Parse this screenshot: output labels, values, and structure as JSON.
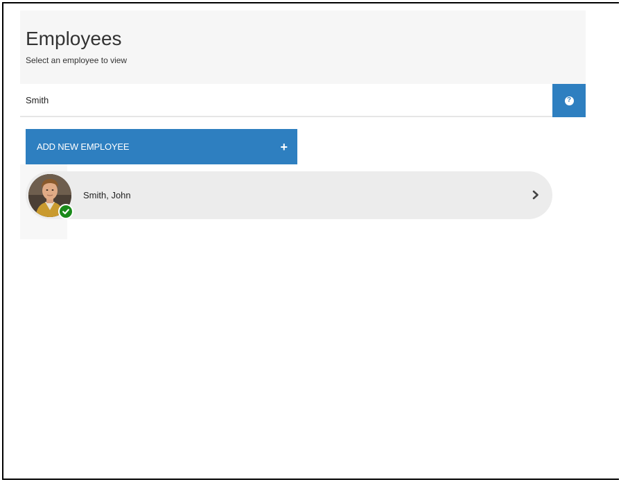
{
  "header": {
    "title": "Employees",
    "subtitle": "Select an employee to view"
  },
  "search": {
    "value": "Smith",
    "help_icon": "question-circle-icon"
  },
  "actions": {
    "add_label": "ADD NEW EMPLOYEE",
    "add_icon": "+"
  },
  "employees": [
    {
      "name": "Smith, John",
      "status": "active",
      "status_icon": "check-icon",
      "status_color": "#1a8a1a"
    }
  ],
  "colors": {
    "accent": "#2e7fc0",
    "row_background": "#ececec",
    "header_background": "#f6f6f6"
  }
}
